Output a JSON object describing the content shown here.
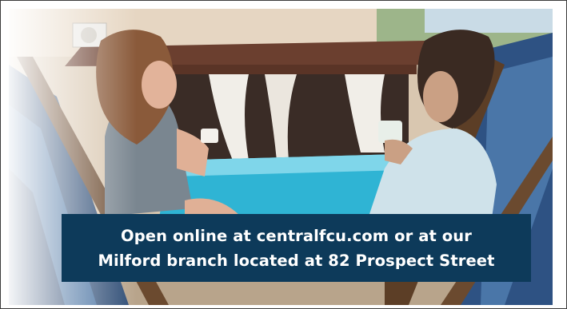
{
  "photo": {
    "subject": "couple-on-deck-chairs-by-pool-image"
  },
  "caption": {
    "line1": "Open online at centralfcu.com or at our",
    "line2": "Milford branch located at 82 Prospect Street"
  },
  "colors": {
    "caption_background": "#0d3a5a",
    "caption_text": "#ffffff"
  }
}
